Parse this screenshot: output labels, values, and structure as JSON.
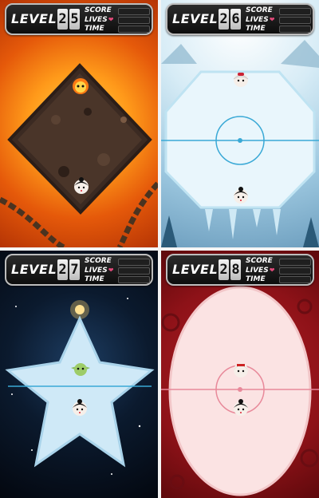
{
  "hud": {
    "level_label": "LEVEL",
    "score_label": "SCORE",
    "lives_label": "LIVES",
    "time_label": "TIME",
    "heart_glyph": "❤"
  },
  "panels": [
    {
      "theme": "fire",
      "level_digits": [
        "2",
        "5"
      ]
    },
    {
      "theme": "ice",
      "level_digits": [
        "2",
        "6"
      ]
    },
    {
      "theme": "space",
      "level_digits": [
        "2",
        "7"
      ]
    },
    {
      "theme": "red-pattern",
      "level_digits": [
        "2",
        "8"
      ]
    }
  ],
  "colors": {
    "hud_bg": "#111111",
    "hud_border": "#bdbdbd",
    "heart": "#e24a7a",
    "ice_line": "#3aa9d6",
    "rink_red_line": "#e8899a"
  }
}
